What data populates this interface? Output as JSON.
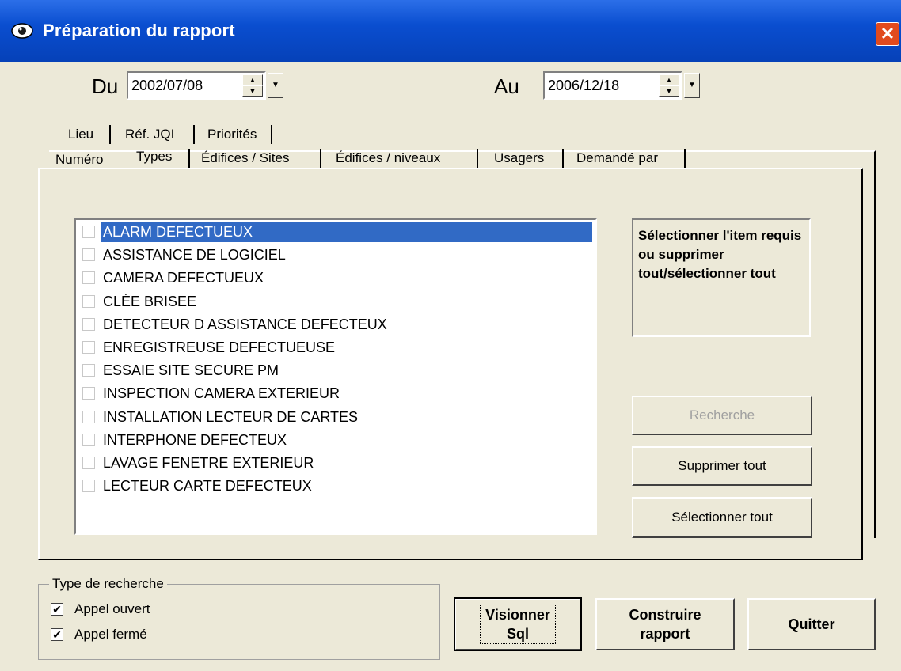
{
  "window": {
    "title": "Préparation du rapport",
    "close_label": "✕"
  },
  "dates": {
    "from_label": "Du",
    "from_value": "2002/07/08",
    "to_label": "Au",
    "to_value": "2006/12/18"
  },
  "tabs": {
    "row_back": [
      "Lieu",
      "Réf. JQI",
      "Priorités"
    ],
    "row_front": [
      "Numéro",
      "Types",
      "Édifices / Sites",
      "Édifices / niveaux",
      "Usagers",
      "Demandé par"
    ],
    "active": "Types"
  },
  "types_list": {
    "items": [
      "ALARM DEFECTUEUX",
      "ASSISTANCE DE LOGICIEL",
      "CAMERA DEFECTUEUX",
      "CLÉE BRISEE",
      "DETECTEUR D ASSISTANCE DEFECTEUX",
      "ENREGISTREUSE DEFECTUEUSE",
      "ESSAIE SITE SECURE PM",
      "INSPECTION CAMERA EXTERIEUR",
      "INSTALLATION LECTEUR DE CARTES",
      "INTERPHONE DEFECTEUX",
      "LAVAGE FENETRE EXTERIEUR",
      "LECTEUR CARTE DEFECTEUX"
    ],
    "selected": "ALARM DEFECTUEUX"
  },
  "info_text": "Sélectionner l'item requis ou supprimer tout/sélectionner tout",
  "buttons": {
    "search": "Recherche",
    "remove_all": "Supprimer tout",
    "select_all": "Sélectionner tout",
    "view_sql_line1": "Visionner",
    "view_sql_line2": "Sql",
    "build_line1": "Construire",
    "build_line2": "rapport",
    "quit": "Quitter"
  },
  "search_type": {
    "label": "Type de recherche",
    "options": [
      {
        "label": "Appel ouvert",
        "checked": true
      },
      {
        "label": "Appel fermé",
        "checked": true
      }
    ]
  },
  "colors": {
    "titlebar": "#0A4ED0",
    "selection": "#316AC5",
    "face": "#ECE9D8"
  }
}
